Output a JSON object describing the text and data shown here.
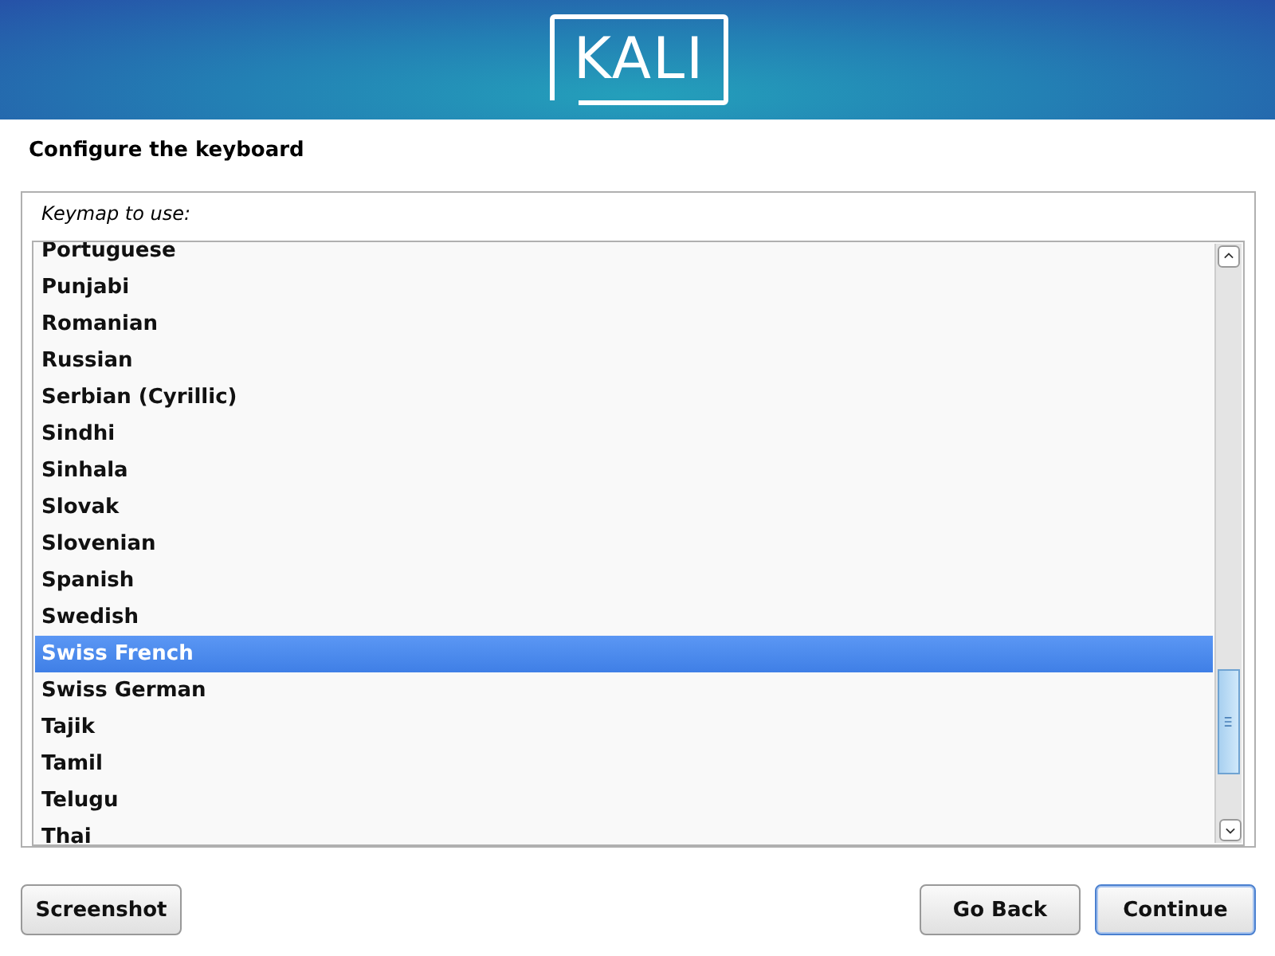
{
  "header": {
    "logo": "KALI"
  },
  "title": "Configure the keyboard",
  "keymap": {
    "label": "Keymap to use:",
    "items": [
      {
        "label": "Portuguese",
        "selected": false
      },
      {
        "label": "Punjabi",
        "selected": false
      },
      {
        "label": "Romanian",
        "selected": false
      },
      {
        "label": "Russian",
        "selected": false
      },
      {
        "label": "Serbian (Cyrillic)",
        "selected": false
      },
      {
        "label": "Sindhi",
        "selected": false
      },
      {
        "label": "Sinhala",
        "selected": false
      },
      {
        "label": "Slovak",
        "selected": false
      },
      {
        "label": "Slovenian",
        "selected": false
      },
      {
        "label": "Spanish",
        "selected": false
      },
      {
        "label": "Swedish",
        "selected": false
      },
      {
        "label": "Swiss French",
        "selected": true
      },
      {
        "label": "Swiss German",
        "selected": false
      },
      {
        "label": "Tajik",
        "selected": false
      },
      {
        "label": "Tamil",
        "selected": false
      },
      {
        "label": "Telugu",
        "selected": false
      },
      {
        "label": "Thai",
        "selected": false
      }
    ]
  },
  "buttons": [
    {
      "label": "Screenshot",
      "kind": "left"
    },
    {
      "label": "Go Back",
      "kind": "right"
    },
    {
      "label": "Continue",
      "kind": "default"
    }
  ]
}
